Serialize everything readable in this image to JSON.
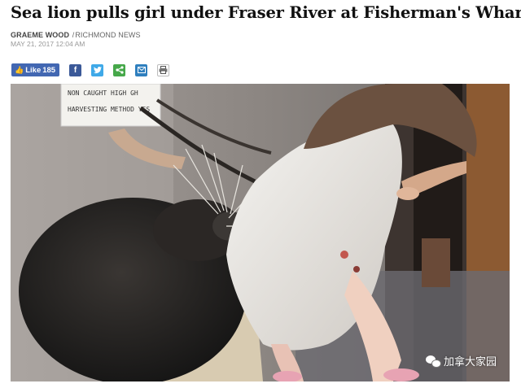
{
  "article": {
    "headline": "Sea lion pulls girl under Fraser River at Fisherman's Wharf",
    "author": "GRAEME WOOD",
    "separator": "/",
    "outlet": "RICHMOND NEWS",
    "date": "MAY 21, 2017 12:04 AM"
  },
  "share": {
    "like_label": "Like",
    "like_count": "185",
    "icons": [
      "facebook-icon",
      "twitter-icon",
      "share-icon",
      "email-icon",
      "print-icon"
    ]
  },
  "photo": {
    "sign_line1": "NON CAUGHT HIGH GH",
    "sign_line2": "HARVESTING METHOD YES"
  },
  "watermark": {
    "text": "加拿大家园"
  },
  "colors": {
    "facebook": "#3b5998",
    "twitter": "#3fa9e8",
    "share": "#46a84a",
    "email": "#2f7fbe"
  }
}
